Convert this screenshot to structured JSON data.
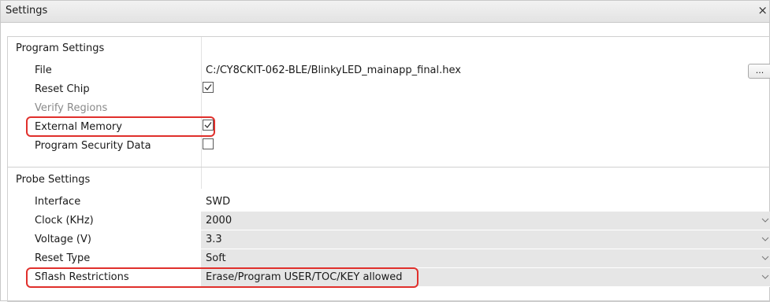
{
  "window": {
    "title": "Settings",
    "close_glyph": "×"
  },
  "program_settings": {
    "section_label": "Program Settings",
    "file": {
      "label": "File",
      "value": "C:/CY8CKIT-062-BLE/BlinkyLED_mainapp_final.hex",
      "browse_label": "..."
    },
    "reset_chip": {
      "label": "Reset Chip",
      "checked": true
    },
    "verify_regions": {
      "label": "Verify Regions",
      "disabled": true
    },
    "external_memory": {
      "label": "External Memory",
      "checked": true
    },
    "program_security_data": {
      "label": "Program Security Data",
      "checked": false
    }
  },
  "probe_settings": {
    "section_label": "Probe Settings",
    "interface": {
      "label": "Interface",
      "value": "SWD"
    },
    "clock": {
      "label": "Clock (KHz)",
      "value": "2000"
    },
    "voltage": {
      "label": "Voltage (V)",
      "value": "3.3"
    },
    "reset_type": {
      "label": "Reset Type",
      "value": "Soft"
    },
    "sflash_restrictions": {
      "label": "Sflash Restrictions",
      "value": "Erase/Program USER/TOC/KEY allowed"
    }
  },
  "highlight_color": "#e0302c"
}
